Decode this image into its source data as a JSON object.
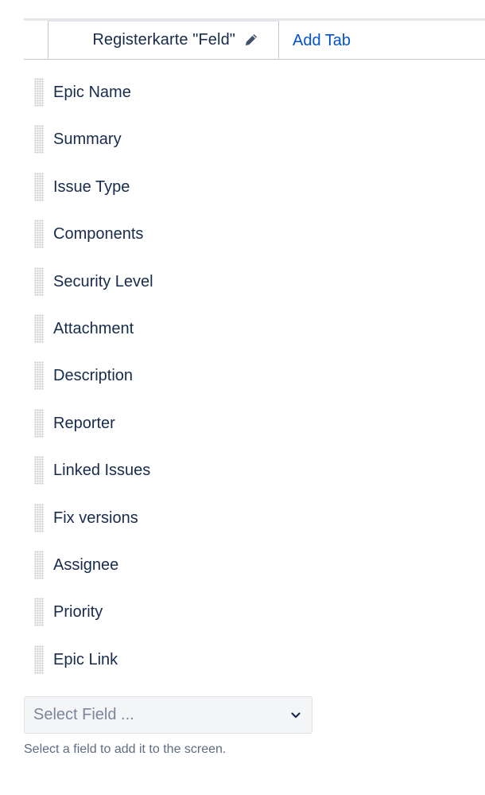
{
  "tabs": {
    "active_label": "Registerkarte \"Feld\"",
    "add_tab_label": "Add Tab"
  },
  "fields": [
    {
      "label": "Epic Name"
    },
    {
      "label": "Summary"
    },
    {
      "label": "Issue Type"
    },
    {
      "label": "Components"
    },
    {
      "label": "Security Level"
    },
    {
      "label": "Attachment"
    },
    {
      "label": "Description"
    },
    {
      "label": "Reporter"
    },
    {
      "label": "Linked Issues"
    },
    {
      "label": "Fix versions"
    },
    {
      "label": "Assignee"
    },
    {
      "label": "Priority"
    },
    {
      "label": "Epic Link"
    }
  ],
  "select_field": {
    "placeholder": "Select Field ..."
  },
  "help_text": "Select a field to add it to the screen.",
  "icons": {
    "edit": "pencil-icon",
    "drag": "drag-handle-icon",
    "dropdown": "chevron-down-icon"
  },
  "colors": {
    "link": "#0052cc",
    "text": "#172b4d",
    "muted": "#5e6c84",
    "placeholder": "#7a869a",
    "border": "#c1c7d0",
    "select_bg": "#f4f5f7"
  }
}
